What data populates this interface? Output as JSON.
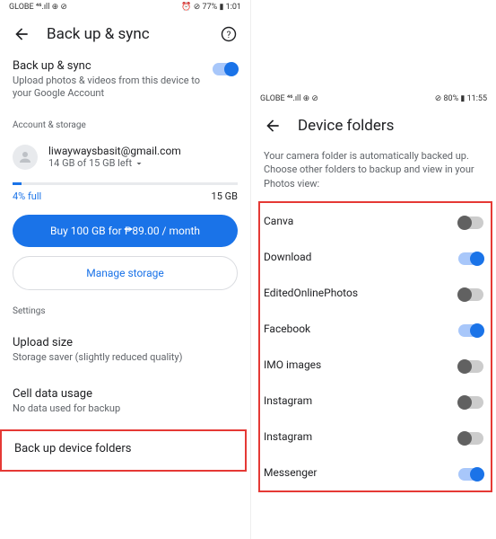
{
  "left": {
    "status": {
      "carrier": "GLOBE ⁴⁶.ıll ⊕ ⊘",
      "right": "⏰ ⊘ 77% ▮ 1:01"
    },
    "header": {
      "title": "Back up & sync"
    },
    "backup": {
      "title": "Back up & sync",
      "subtitle": "Upload photos & videos from this device to your Google Account"
    },
    "section_account": "Account & storage",
    "account": {
      "email": "liwaywaysbasit@gmail.com",
      "storage": "14 GB of 15 GB left"
    },
    "progress": {
      "pct": "4% full",
      "total": "15 GB"
    },
    "buy_btn": "Buy 100 GB for ₱89.00 / month",
    "manage_btn": "Manage storage",
    "section_settings": "Settings",
    "upload": {
      "title": "Upload size",
      "sub": "Storage saver (slightly reduced quality)"
    },
    "cell": {
      "title": "Cell data usage",
      "sub": "No data used for backup"
    },
    "device_folders": "Back up device folders"
  },
  "right": {
    "status": {
      "carrier": "GLOBE ⁴⁶.ıll ⊕ ⊘",
      "right": "⊘ 80% ▮ 11:55"
    },
    "header": {
      "title": "Device folders"
    },
    "desc": "Your camera folder is automatically backed up. Choose other folders to backup and view in your Photos view:",
    "folders": [
      {
        "name": "Canva",
        "on": false
      },
      {
        "name": "Download",
        "on": true
      },
      {
        "name": "EditedOnlinePhotos",
        "on": false
      },
      {
        "name": "Facebook",
        "on": true
      },
      {
        "name": "IMO images",
        "on": false
      },
      {
        "name": "Instagram",
        "on": false
      },
      {
        "name": "Instagram",
        "on": false
      },
      {
        "name": "Messenger",
        "on": true
      }
    ]
  }
}
